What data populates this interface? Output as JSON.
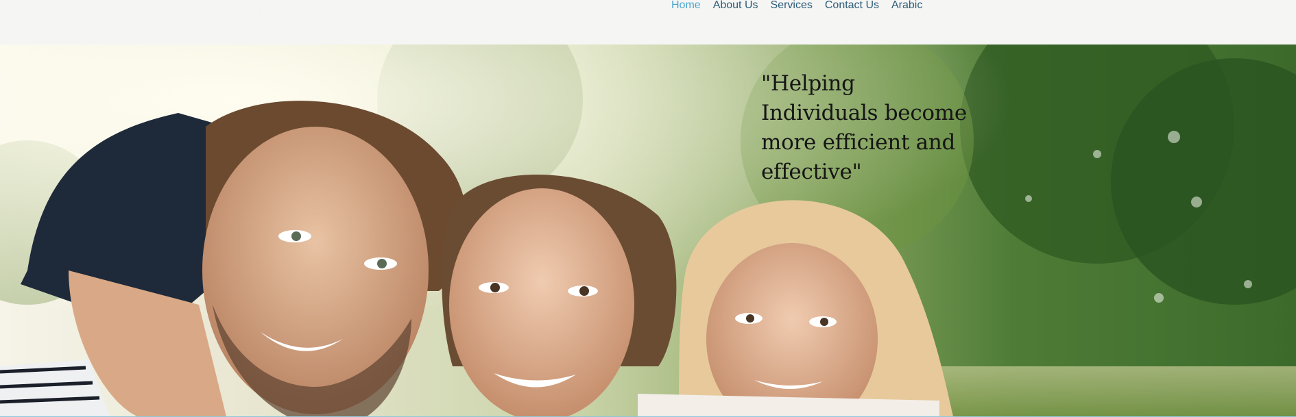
{
  "nav": {
    "items": [
      {
        "label": "Home",
        "active": true
      },
      {
        "label": "About Us",
        "active": false
      },
      {
        "label": "Services",
        "active": false
      },
      {
        "label": "Contact Us",
        "active": false
      },
      {
        "label": "Arabic",
        "active": false
      }
    ]
  },
  "hero": {
    "quote": "\"Helping Individuals become more efficient and effective\"",
    "image_description_icon": "family-photo"
  },
  "colors": {
    "nav_text": "#2c5c78",
    "nav_active": "#4aa6cf",
    "quote_text": "#151515",
    "header_bg": "#f5f5f4"
  }
}
